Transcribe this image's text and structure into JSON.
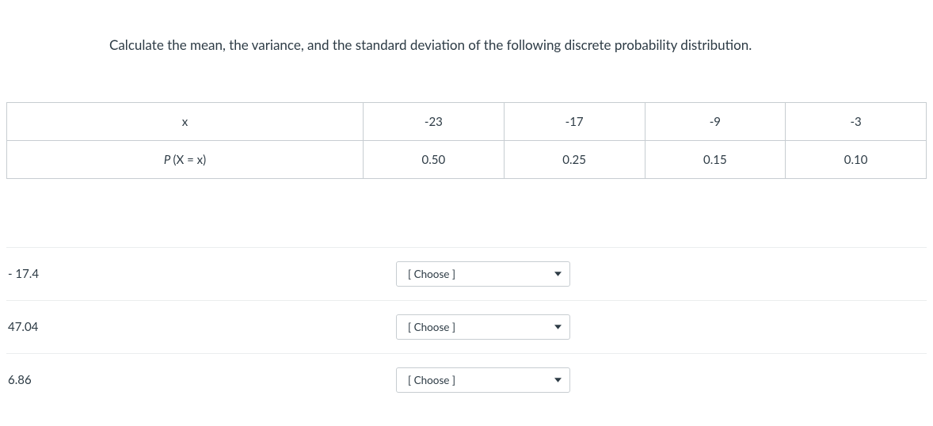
{
  "prompt": "Calculate the mean, the variance, and the standard deviation of the following discrete probability distribution.",
  "table": {
    "row1": {
      "label": "x",
      "c1": "-23",
      "c2": "-17",
      "c3": "-9",
      "c4": "-3"
    },
    "row2": {
      "label_prefix": "P ",
      "label_paren": "(X = x)",
      "c1": "0.50",
      "c2": "0.25",
      "c3": "0.15",
      "c4": "0.10"
    }
  },
  "matches": [
    {
      "value": "- 17.4",
      "select": "[ Choose ]"
    },
    {
      "value": "47.04",
      "select": "[ Choose ]"
    },
    {
      "value": "6.86",
      "select": "[ Choose ]"
    }
  ]
}
